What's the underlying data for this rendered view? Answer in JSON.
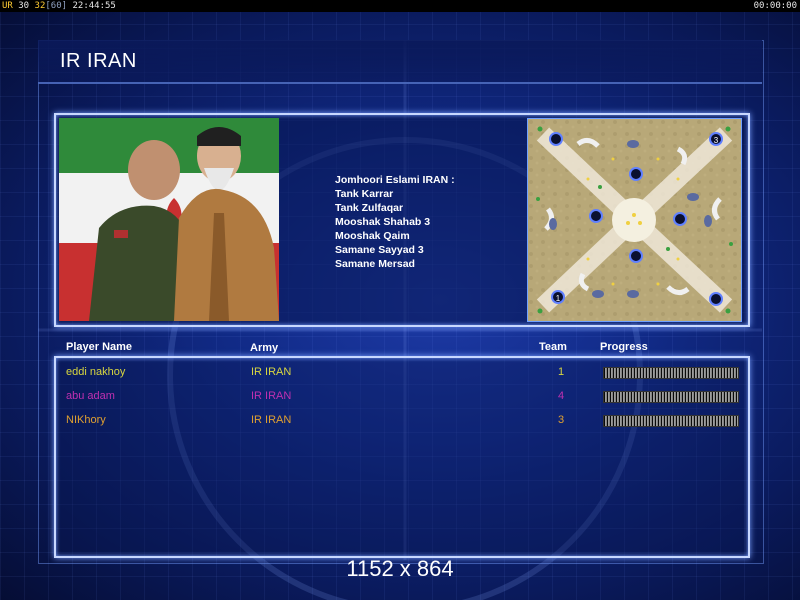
{
  "status_bar": {
    "left_prefix": "UR",
    "val_a": "30",
    "val_b": "32",
    "val_c": "[60]",
    "clock": "22:44:55",
    "timer": "00:00:00"
  },
  "panel": {
    "title": "IR IRAN"
  },
  "army_info": {
    "heading": "Jomhoori Eslami IRAN :",
    "units": [
      "Tank Karrar",
      "Tank Zulfaqar",
      "Mooshak Shahab 3",
      "Mooshak Qaim",
      "Samane Sayyad 3",
      "Samane Mersad"
    ]
  },
  "table": {
    "headers": {
      "player": "Player Name",
      "army": "Army",
      "team": "Team",
      "progress": "Progress"
    },
    "rows": [
      {
        "name": "eddi nakhoy",
        "army": "IR IRAN",
        "team": "1",
        "color": "#d8d640",
        "progress": 1.0
      },
      {
        "name": "abu adam",
        "army": "IR IRAN",
        "team": "4",
        "color": "#c030b0",
        "progress": 1.0
      },
      {
        "name": "NIKhory",
        "army": "IR IRAN",
        "team": "3",
        "color": "#e0a030",
        "progress": 1.0
      }
    ]
  },
  "minimap": {
    "start_labels": [
      "1",
      "3"
    ]
  },
  "resolution": "1152 x 864"
}
